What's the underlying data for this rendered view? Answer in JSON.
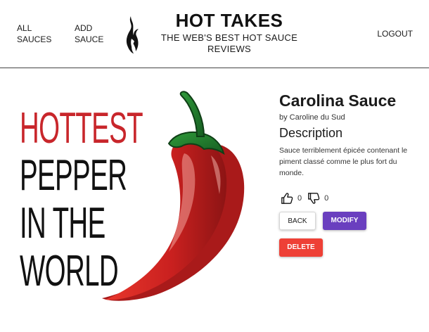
{
  "header": {
    "nav_all_sauces": "ALL SAUCES",
    "nav_add_sauce": "ADD SAUCE",
    "nav_logout": "LOGOUT",
    "title": "HOT TAKES",
    "subtitle": "THE WEB'S BEST HOT SAUCE REVIEWS",
    "logo_icon": "flame-icon"
  },
  "image": {
    "lines": [
      "HOTTEST",
      "PEPPER",
      "IN THE",
      "WORLD"
    ],
    "icon": "chili-pepper-icon",
    "accent_color": "#c8262b"
  },
  "sauce": {
    "name": "Carolina Sauce",
    "manufacturer": "by Caroline du Sud",
    "description_heading": "Description",
    "description": "Sauce terriblement épicée contenant le piment classé comme le plus fort du monde.",
    "likes": "0",
    "dislikes": "0",
    "like_icon": "thumbs-up-icon",
    "dislike_icon": "thumbs-down-icon"
  },
  "actions": {
    "back_label": "BACK",
    "modify_label": "MODIFY",
    "delete_label": "DELETE",
    "modify_color": "#6a3fbf",
    "delete_color": "#ee4036"
  }
}
